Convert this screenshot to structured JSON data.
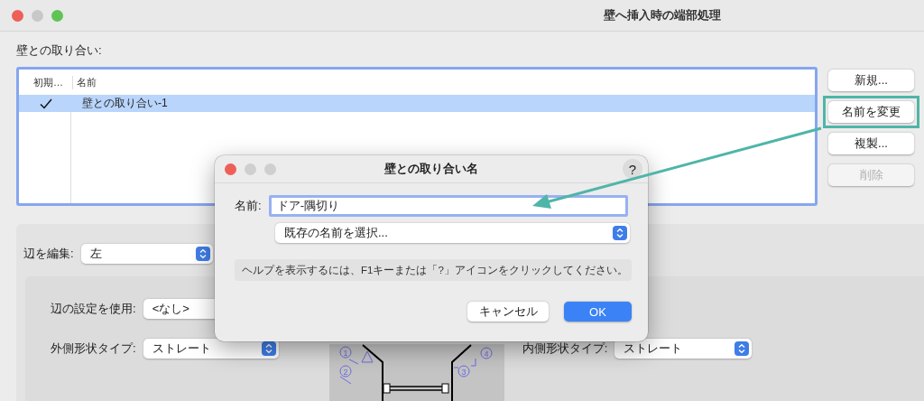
{
  "window": {
    "title": "壁へ挿入時の端部処理"
  },
  "connections": {
    "label": "壁との取り合い:",
    "columns": [
      "初期…",
      "名前"
    ],
    "rows": [
      {
        "default": true,
        "name": "壁との取り合い-1",
        "selected": true
      }
    ]
  },
  "buttons": [
    {
      "label": "新規...",
      "disabled": false,
      "highlighted": false
    },
    {
      "label": "名前を変更",
      "disabled": false,
      "highlighted": true
    },
    {
      "label": "複製...",
      "disabled": false,
      "highlighted": false
    },
    {
      "label": "削除",
      "disabled": true,
      "highlighted": false
    }
  ],
  "edge_editor": {
    "label": "辺を編集:",
    "value": "左",
    "use_settings": {
      "label": "辺の設定を使用:",
      "value": "<なし>"
    },
    "outer_shape": {
      "label": "外側形状タイプ:",
      "value": "ストレート"
    },
    "inner_shape": {
      "label": "内側形状タイプ:",
      "value": "ストレート"
    },
    "diagram_labels": [
      "1",
      "2",
      "3",
      "4"
    ]
  },
  "dialog": {
    "title": "壁との取り合い名",
    "help_button": "?",
    "name_label": "名前:",
    "name_value": "ドア-隅切り",
    "preset_value": "既存の名前を選択...",
    "help_text": "ヘルプを表示するには、F1キーまたは「?」アイコンをクリックしてください。",
    "cancel": "キャンセル",
    "ok": "OK"
  }
}
